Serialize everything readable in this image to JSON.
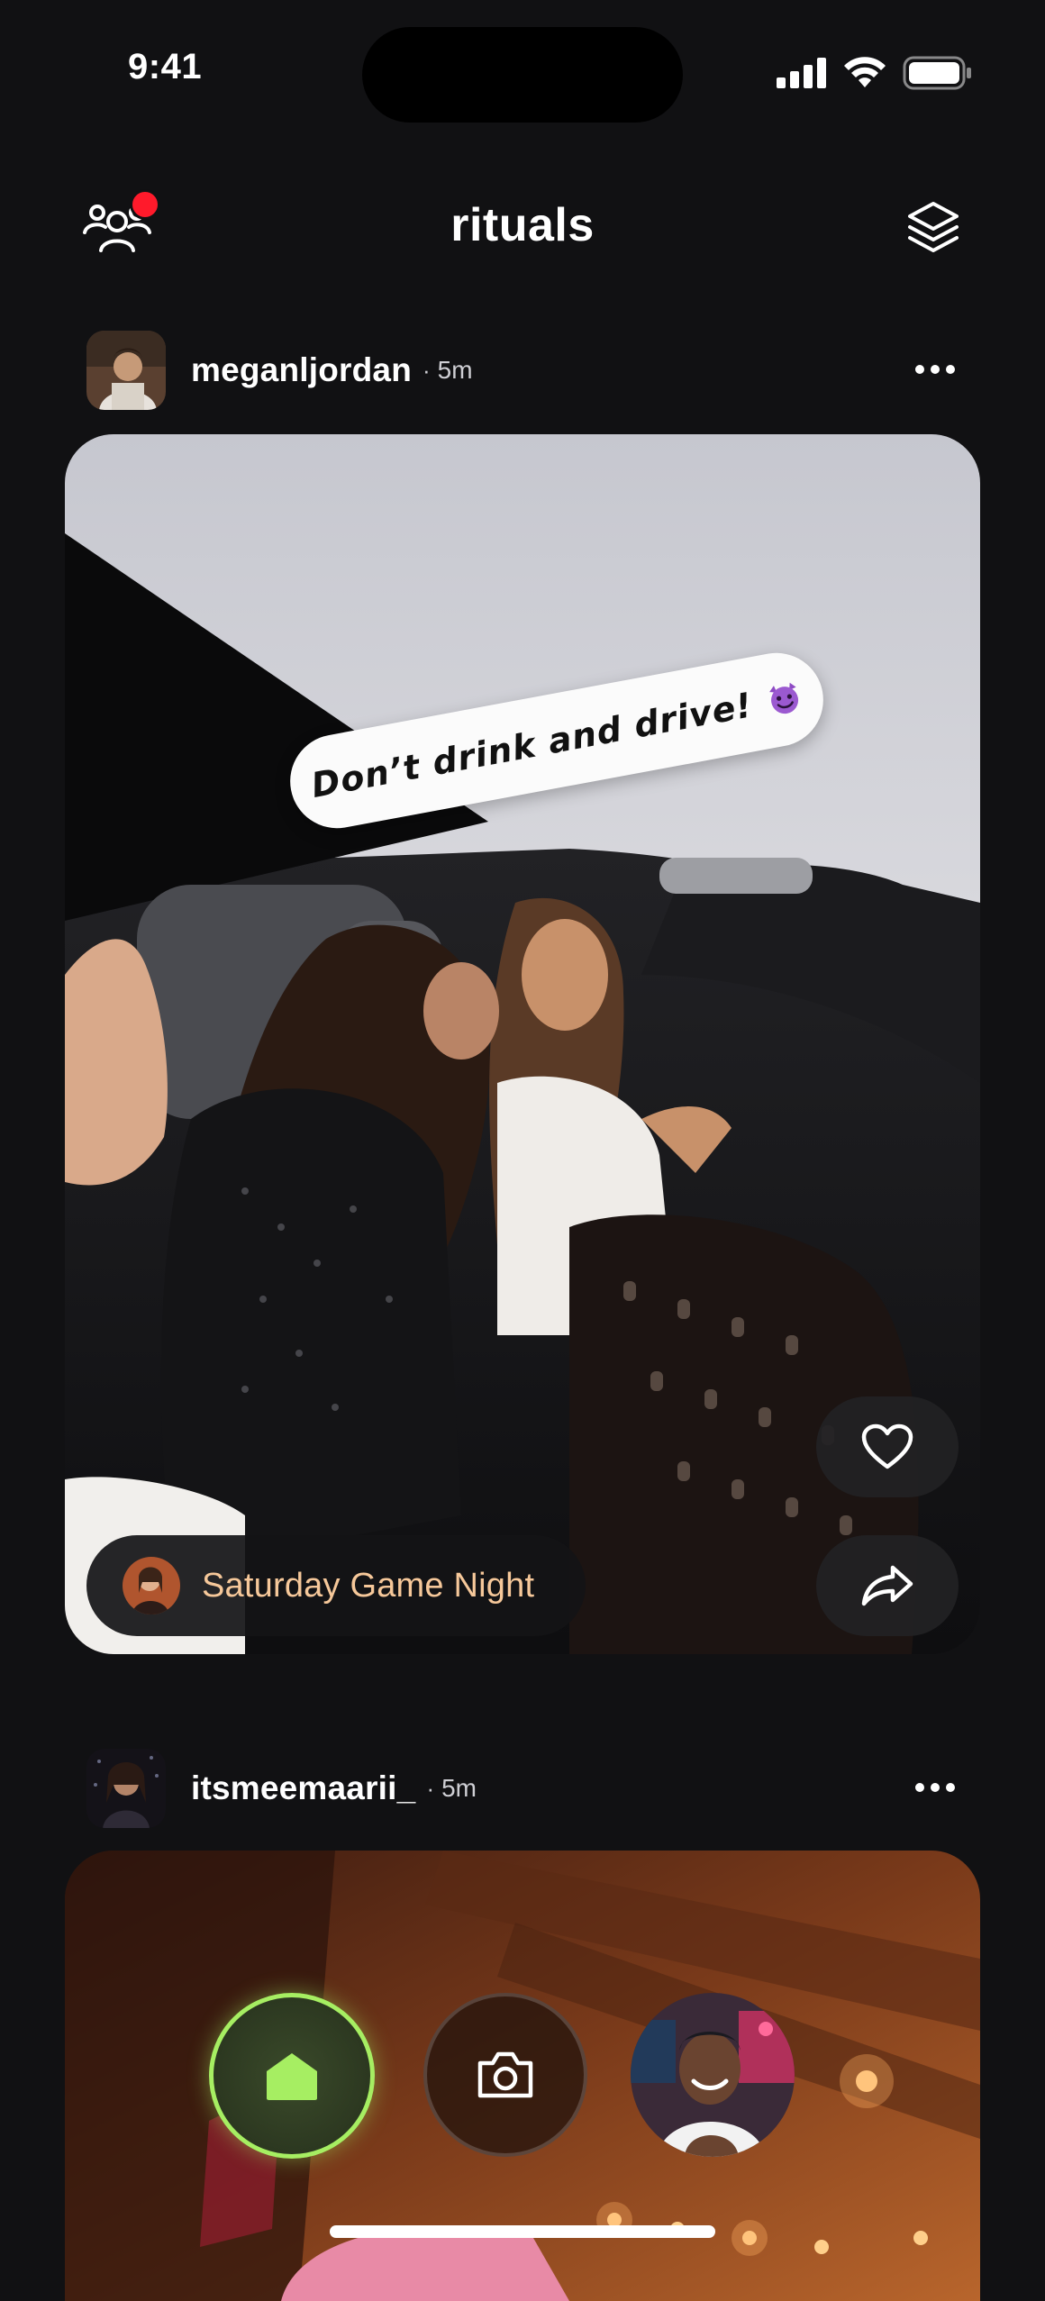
{
  "status_bar": {
    "time": "9:41",
    "icons": [
      "cellular-signal-icon",
      "wifi-icon",
      "battery-icon"
    ]
  },
  "header": {
    "title": "rituals",
    "left_icon": "friends-icon",
    "right_icon": "layers-icon",
    "notification_color": "#ff1a2b"
  },
  "posts": [
    {
      "username": "meganljordan",
      "separator": "·",
      "time": "5m",
      "caption": "Don’t drink and drive!",
      "caption_emoji": "smiling-devil-emoji",
      "event_label": "Saturday Game Night",
      "actions": [
        "heart-icon",
        "share-icon"
      ]
    },
    {
      "username": "itsmeemaarii_",
      "separator": "·",
      "time": "5m"
    }
  ],
  "bottom_nav": {
    "items": [
      "home-icon",
      "camera-icon",
      "profile-avatar"
    ],
    "active": "home-icon",
    "accent": "#a6ee62"
  },
  "colors": {
    "background": "#111113",
    "event_label": "#f6c89a"
  }
}
